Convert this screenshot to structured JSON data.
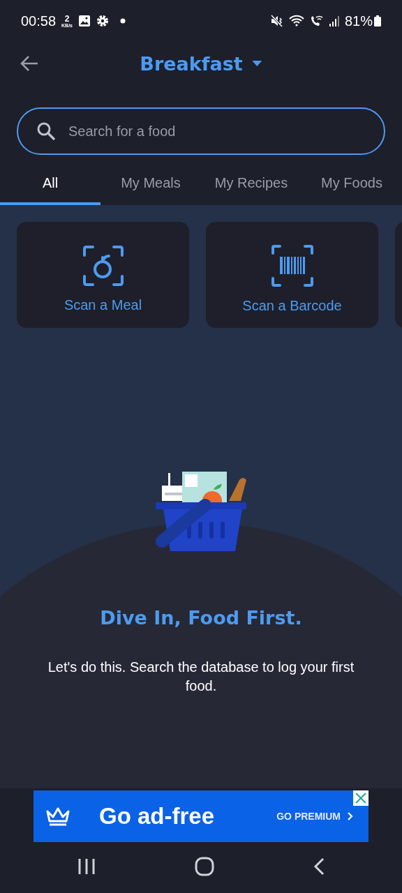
{
  "status_bar": {
    "time": "00:58",
    "speed_value": "2",
    "speed_unit": "KB/s",
    "battery": "81%"
  },
  "header": {
    "title": "Breakfast"
  },
  "search": {
    "placeholder": "Search for a food"
  },
  "tabs": [
    {
      "label": "All",
      "selected": true
    },
    {
      "label": "My Meals",
      "selected": false
    },
    {
      "label": "My Recipes",
      "selected": false
    },
    {
      "label": "My Foods",
      "selected": false
    }
  ],
  "actions": [
    {
      "kind": "meal",
      "label": "Scan a Meal"
    },
    {
      "kind": "barcode",
      "label": "Scan a Barcode"
    }
  ],
  "empty_state": {
    "title": "Dive In, Food First.",
    "message": "Let's do this. Search the database to log your first food."
  },
  "ad": {
    "headline": "Go ad-free",
    "cta": "GO PREMIUM"
  }
}
